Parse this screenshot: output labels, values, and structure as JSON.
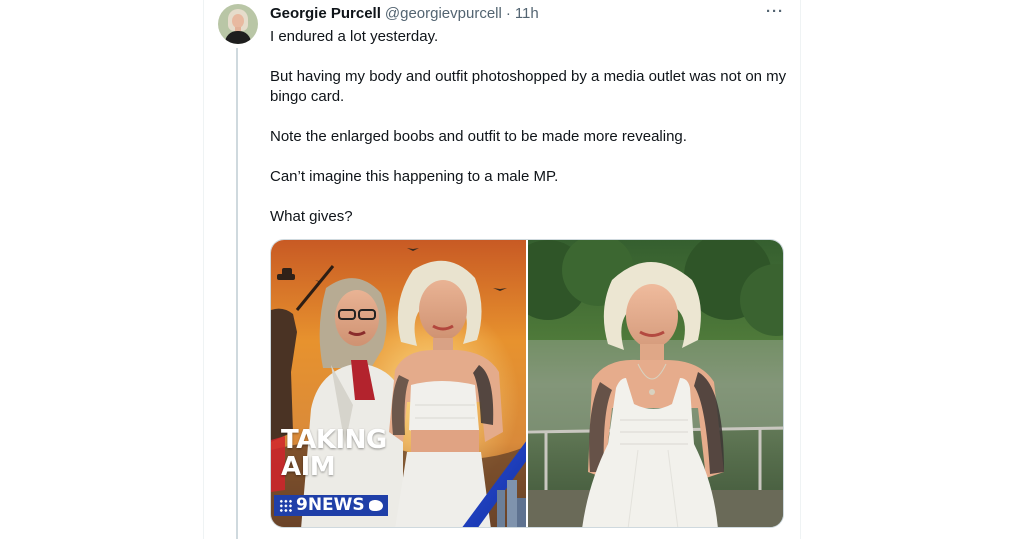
{
  "tweet": {
    "display_name": "Georgie Purcell",
    "handle": "@georgievpurcell",
    "separator": "·",
    "time": "11h",
    "more_label": "···",
    "paragraphs": [
      "I endured a lot yesterday.",
      "But having my body and outfit photoshopped by a media outlet was not on my bingo card.",
      "Note the enlarged boobs and outfit to be made more revealing.",
      "Can’t imagine this happening to a male MP.",
      "What gives?"
    ]
  },
  "media": {
    "left_image": {
      "overlay_title_line1": "TAKING",
      "overlay_title_line2": "AIM",
      "logo_text": "9NEWS"
    }
  },
  "colors": {
    "text_primary": "#0f1419",
    "text_secondary": "#536471",
    "thread_line": "#cfd9de",
    "news_blue": "#1f3fa8"
  }
}
